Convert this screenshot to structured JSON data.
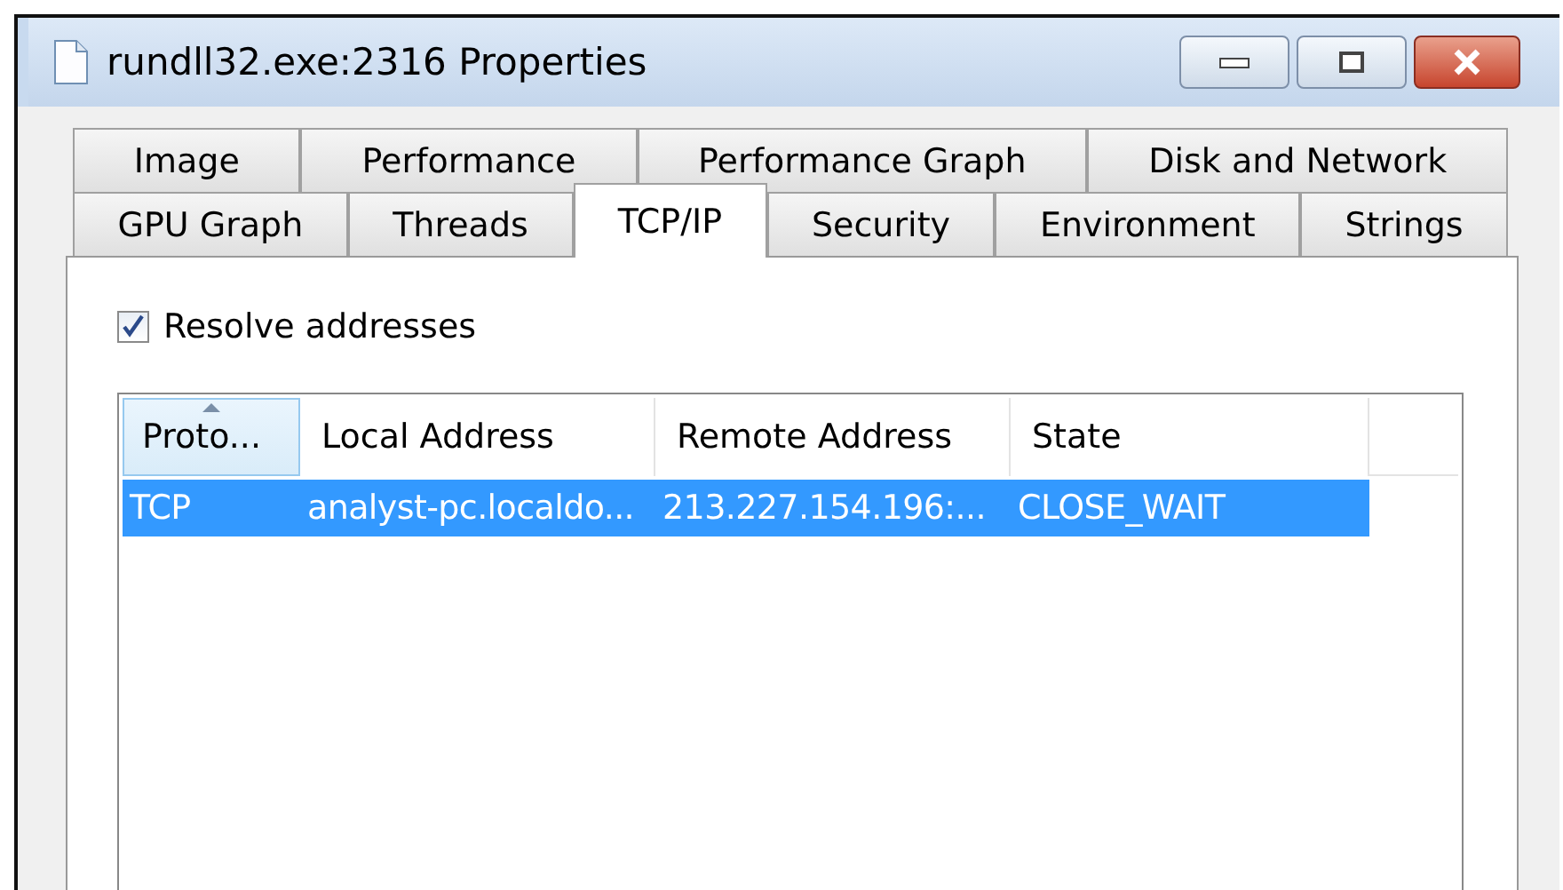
{
  "window": {
    "title": "rundll32.exe:2316 Properties"
  },
  "tab_rows": [
    [
      {
        "label": "Image",
        "selected": false
      },
      {
        "label": "Performance",
        "selected": false
      },
      {
        "label": "Performance Graph",
        "selected": false
      },
      {
        "label": "Disk and Network",
        "selected": false
      }
    ],
    [
      {
        "label": "GPU Graph",
        "selected": false
      },
      {
        "label": "Threads",
        "selected": false
      },
      {
        "label": "TCP/IP",
        "selected": true
      },
      {
        "label": "Security",
        "selected": false
      },
      {
        "label": "Environment",
        "selected": false
      },
      {
        "label": "Strings",
        "selected": false
      }
    ]
  ],
  "resolve_addresses": {
    "label": "Resolve addresses",
    "checked": true
  },
  "table": {
    "columns": [
      {
        "label": "Proto...",
        "sorted": true
      },
      {
        "label": "Local Address",
        "sorted": false
      },
      {
        "label": "Remote Address",
        "sorted": false
      },
      {
        "label": "State",
        "sorted": false
      }
    ],
    "rows": [
      {
        "cells": [
          "TCP",
          "analyst-pc.localdo...",
          "213.227.154.196:...",
          "CLOSE_WAIT"
        ],
        "selected": true
      }
    ]
  }
}
